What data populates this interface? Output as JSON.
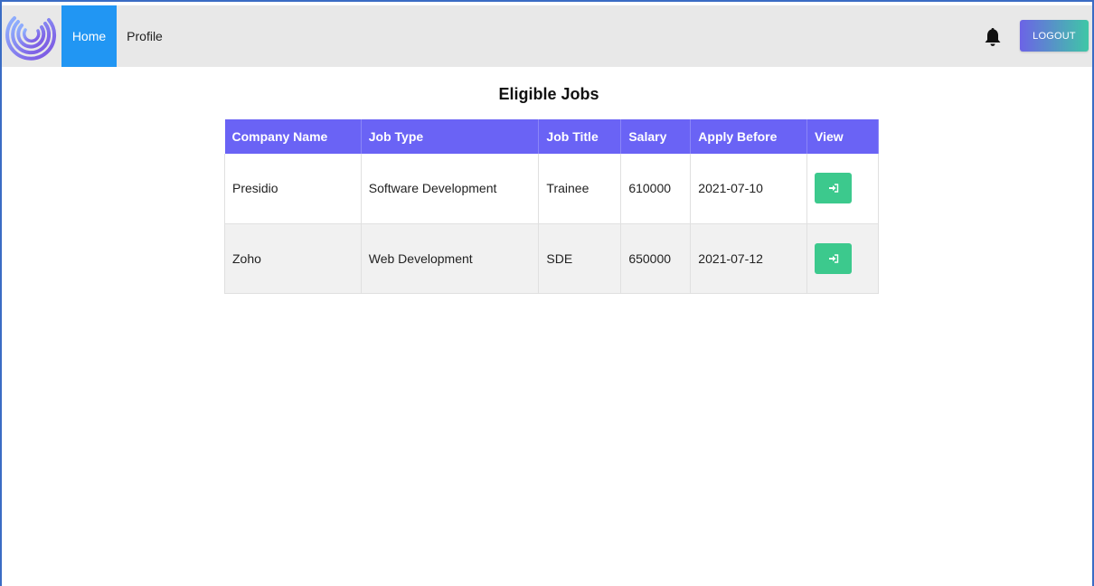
{
  "nav": {
    "home_label": "Home",
    "profile_label": "Profile",
    "logout_label": "LOGOUT",
    "bell_icon": "bell-icon",
    "accent_color": "#2196f3"
  },
  "page": {
    "title": "Eligible Jobs"
  },
  "table": {
    "headers": [
      "Company Name",
      "Job Type",
      "Job Title",
      "Salary",
      "Apply Before",
      "View"
    ],
    "rows": [
      {
        "company": "Presidio",
        "job_type": "Software Development",
        "job_title": "Trainee",
        "salary": "610000",
        "apply_before": "2021-07-10",
        "view_icon": "sign-in-icon"
      },
      {
        "company": "Zoho",
        "job_type": "Web Development",
        "job_title": "SDE",
        "salary": "650000",
        "apply_before": "2021-07-12",
        "view_icon": "sign-in-icon"
      }
    ],
    "header_color": "#6a63f5",
    "button_color": "#3cc98d"
  }
}
